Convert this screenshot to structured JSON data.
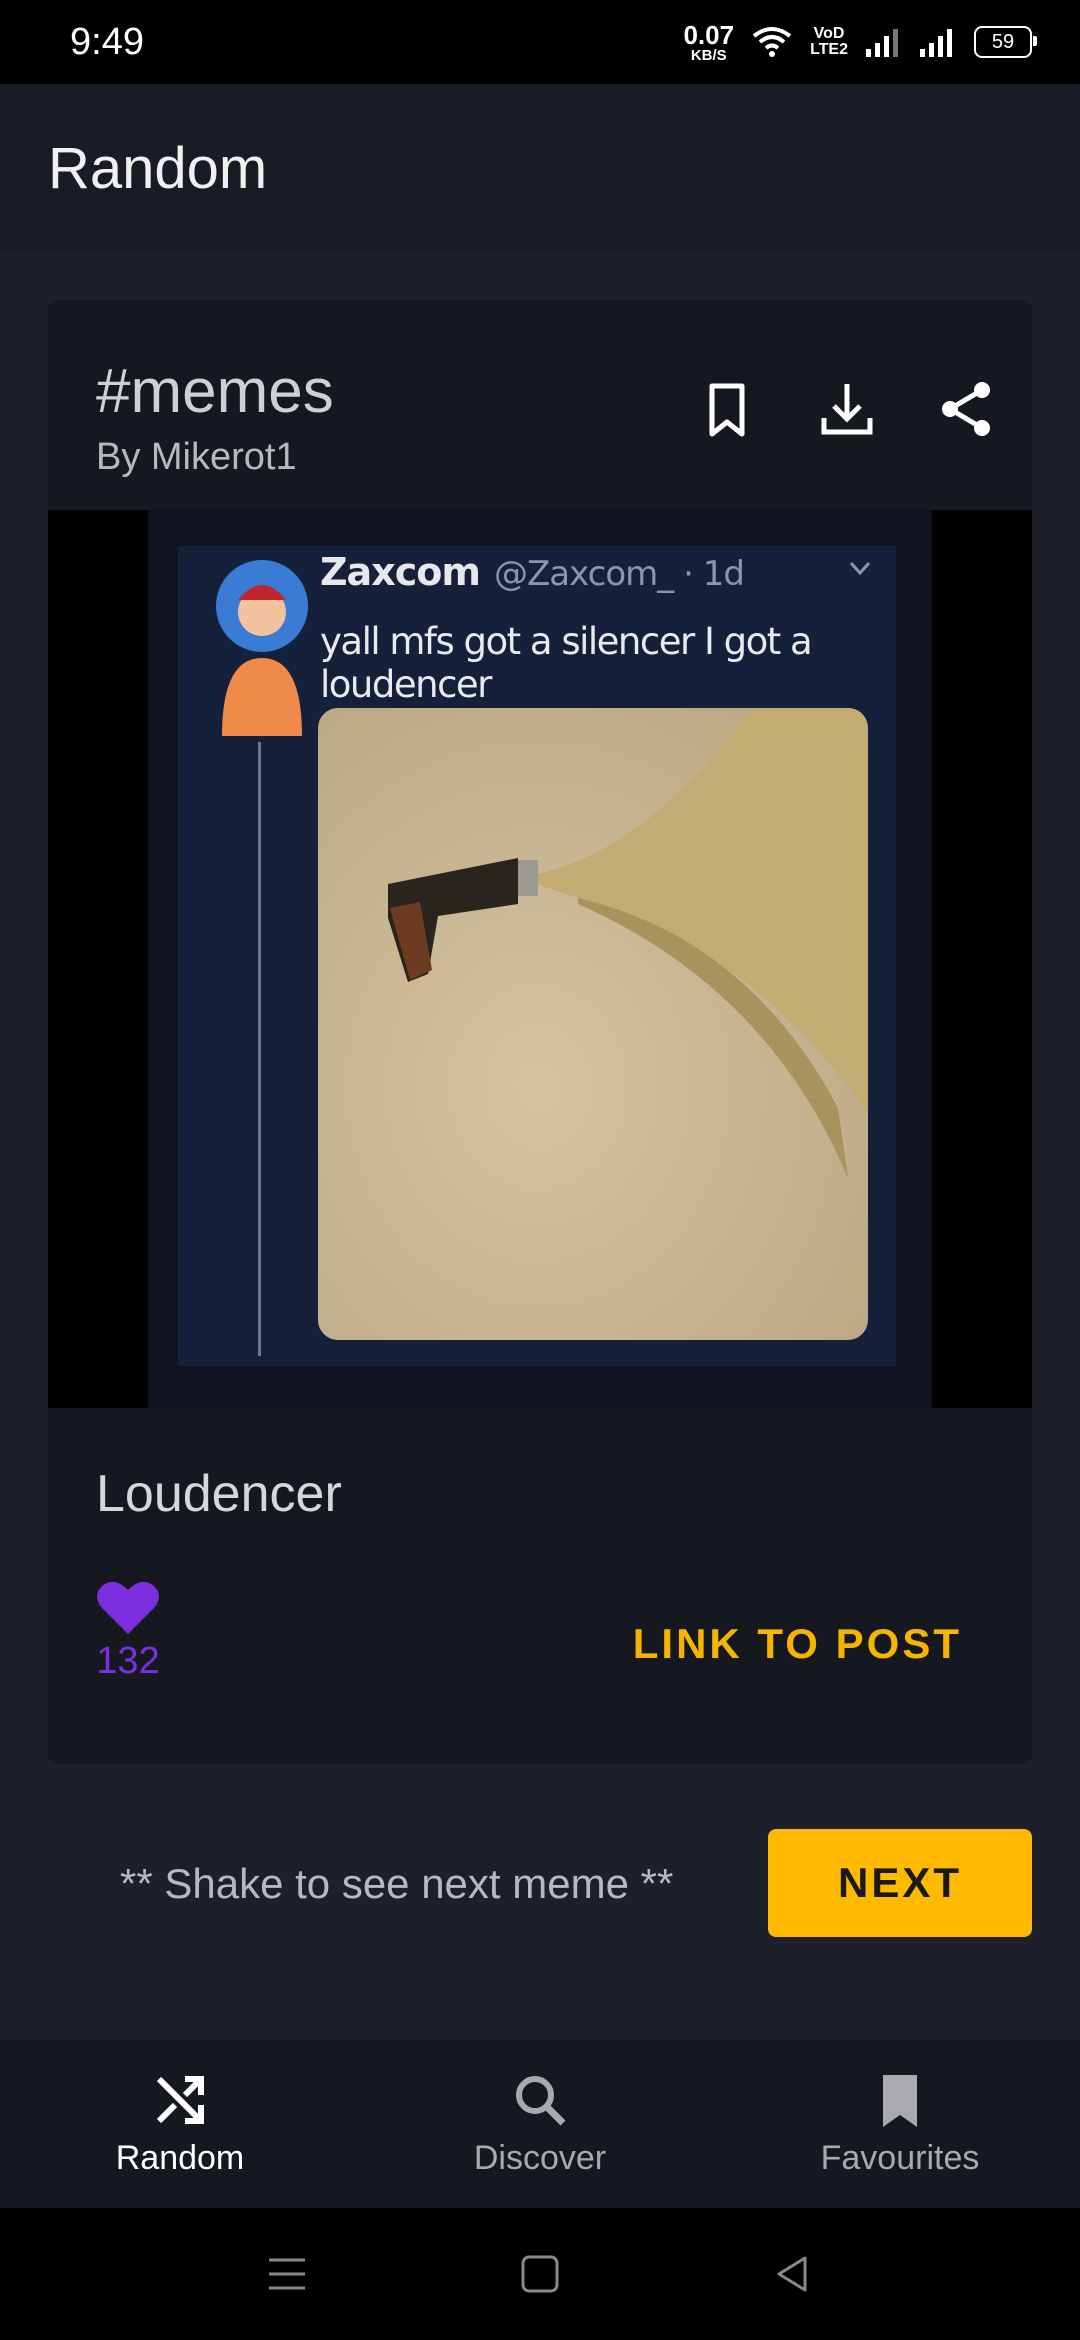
{
  "status_bar": {
    "time": "9:49",
    "net_speed_value": "0.07",
    "net_speed_unit": "KB/S",
    "volte_top": "VoD",
    "volte_bottom": "LTE2",
    "battery": "59"
  },
  "app_bar": {
    "title": "Random"
  },
  "post": {
    "tag": "#memes",
    "author": "By Mikerot1",
    "actions": [
      "bookmark-icon",
      "download-icon",
      "share-icon"
    ],
    "meme": {
      "tweet_name": "Zaxcom",
      "tweet_handle": "@Zaxcom_ · 1d",
      "tweet_text": "yall mfs got a silencer I got a loudencer"
    },
    "caption": "Loudencer",
    "likes": "132",
    "link_label": "LINK TO POST"
  },
  "hint": "** Shake to see next meme **",
  "next_label": "NEXT",
  "bottom_nav": {
    "items": [
      {
        "label": "Random",
        "icon": "shuffle-icon",
        "active": true
      },
      {
        "label": "Discover",
        "icon": "search-icon",
        "active": false
      },
      {
        "label": "Favourites",
        "icon": "bookmark-icon",
        "active": false
      }
    ]
  },
  "colors": {
    "accent": "#ffb900",
    "like": "#7b2fe0",
    "background": "#1d202a",
    "card": "#15181e"
  }
}
